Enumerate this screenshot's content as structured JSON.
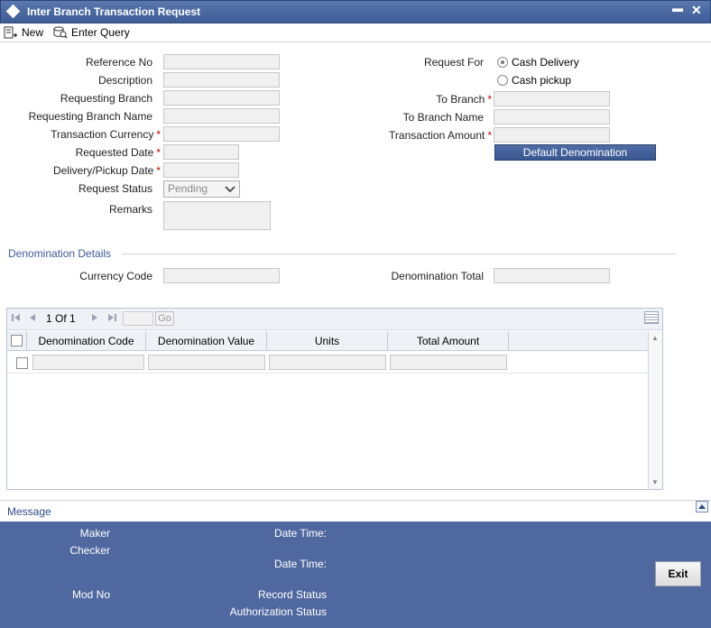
{
  "window": {
    "title": "Inter Branch Transaction Request",
    "minimize": "▬",
    "close": "✕"
  },
  "toolbar": {
    "new_label": "New",
    "enter_query_label": "Enter Query"
  },
  "form": {
    "reference_no": "Reference No",
    "description": "Description",
    "requesting_branch": "Requesting Branch",
    "requesting_branch_name": "Requesting Branch Name",
    "transaction_currency": "Transaction Currency",
    "requested_date": "Requested Date",
    "delivery_pickup_date": "Delivery/Pickup Date",
    "request_status": "Request Status",
    "request_status_value": "Pending",
    "remarks": "Remarks",
    "request_for": "Request For",
    "cash_delivery": "Cash Delivery",
    "cash_pickup": "Cash pickup",
    "to_branch": "To Branch",
    "to_branch_name": "To Branch Name",
    "transaction_amount": "Transaction Amount",
    "default_denomination": "Default Denomination",
    "required_mark": "*"
  },
  "denomination": {
    "section_title": "Denomination Details",
    "currency_code": "Currency Code",
    "denomination_total": "Denomination Total"
  },
  "grid": {
    "page_current": "1",
    "page_of": "Of",
    "page_total": "1",
    "go_label": "Go",
    "columns": [
      "Denomination Code",
      "Denomination Value",
      "Units",
      "Total Amount"
    ]
  },
  "message_bar": {
    "label": "Message"
  },
  "footer": {
    "maker": "Maker",
    "checker": "Checker",
    "date_time": "Date Time:",
    "mod_no": "Mod No",
    "record_status": "Record Status",
    "authorization_status": "Authorization Status",
    "exit_label": "Exit"
  }
}
